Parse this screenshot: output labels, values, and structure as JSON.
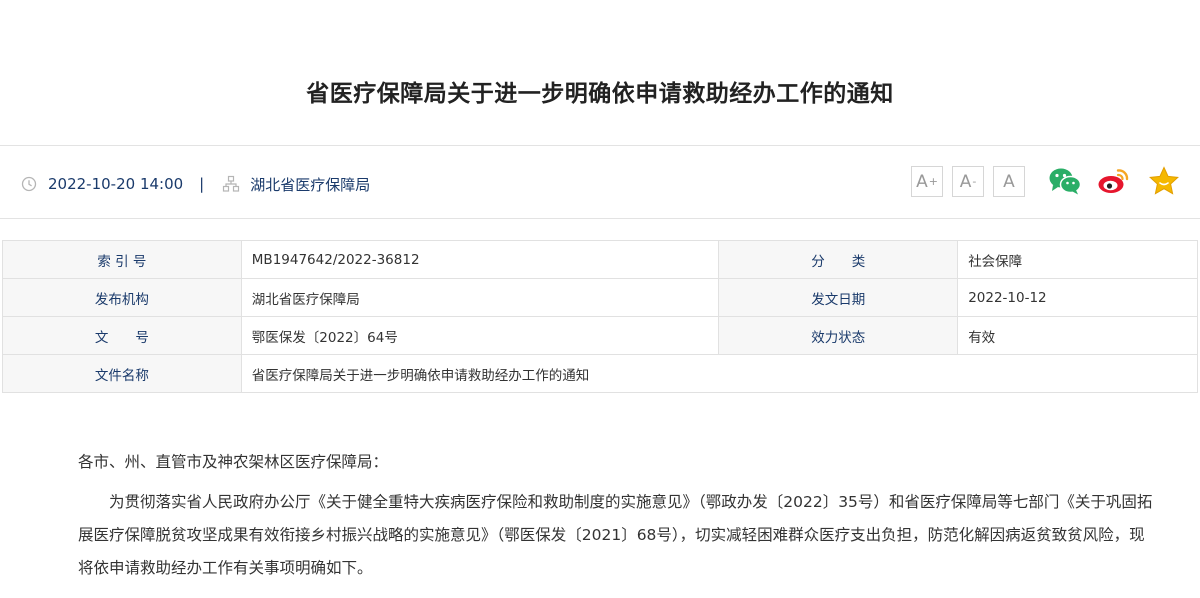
{
  "article": {
    "title": "省医疗保障局关于进一步明确依申请救助经办工作的通知",
    "datetime": "2022-10-20 14:00",
    "separator": "|",
    "source": "湖北省医疗保障局"
  },
  "toolbar": {
    "font_increase": "A",
    "font_increase_mark": "+",
    "font_decrease": "A",
    "font_decrease_mark": "-",
    "font_reset": "A"
  },
  "share": {
    "wechat_icon": "wechat-icon",
    "weibo_icon": "weibo-icon",
    "favorite_icon": "star-icon"
  },
  "info_table": {
    "index_label": "索 引 号",
    "index_value": "MB1947642/2022-36812",
    "category_label": "分　　类",
    "category_value": "社会保障",
    "publisher_label": "发布机构",
    "publisher_value": "湖北省医疗保障局",
    "issue_date_label": "发文日期",
    "issue_date_value": "2022-10-12",
    "doc_no_label": "文　　号",
    "doc_no_value": "鄂医保发〔2022〕64号",
    "status_label": "效力状态",
    "status_value": "有效",
    "doc_name_label": "文件名称",
    "doc_name_value": "省医疗保障局关于进一步明确依申请救助经办工作的通知"
  },
  "content": {
    "salutation": "各市、州、直管市及神农架林区医疗保障局：",
    "paragraph1": "为贯彻落实省人民政府办公厅《关于健全重特大疾病医疗保险和救助制度的实施意见》（鄂政办发〔2022〕35号）和省医疗保障局等七部门《关于巩固拓展医疗保障脱贫攻坚成果有效衔接乡村振兴战略的实施意见》（鄂医保发〔2021〕68号），切实减轻困难群众医疗支出负担，防范化解因病返贫致贫风险，现将依申请救助经办工作有关事项明确如下。"
  },
  "colors": {
    "label_blue": "#1a3a6b",
    "wechat_green": "#2aae67",
    "weibo_red": "#e6162d",
    "star_yellow": "#f5b800"
  }
}
